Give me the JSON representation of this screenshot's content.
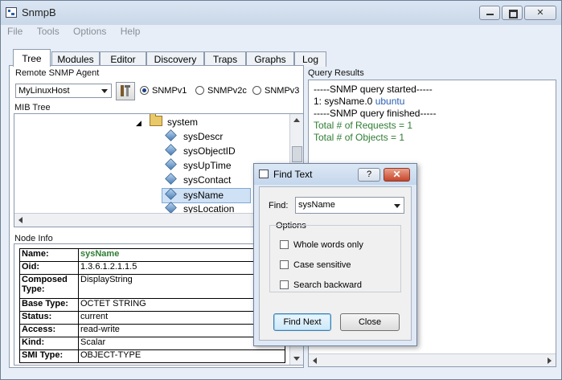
{
  "window": {
    "title": "SnmpB"
  },
  "menu": [
    "File",
    "Tools",
    "Options",
    "Help"
  ],
  "tabs": [
    "Tree",
    "Modules",
    "Editor",
    "Discovery",
    "Traps",
    "Graphs",
    "Log"
  ],
  "agent": {
    "group_label": "Remote SNMP Agent",
    "host": "MyLinuxHost",
    "versions": [
      "SNMPv1",
      "SNMPv2c",
      "SNMPv3"
    ],
    "selected_version": "SNMPv1"
  },
  "mib_tree": {
    "label": "MIB Tree",
    "root": "system",
    "items": [
      "sysDescr",
      "sysObjectID",
      "sysUpTime",
      "sysContact",
      "sysName",
      "sysLocation"
    ],
    "selected": "sysName"
  },
  "node_info": {
    "label": "Node Info",
    "rows": [
      {
        "key": "Name:",
        "value": "sysName"
      },
      {
        "key": "Oid:",
        "value": "1.3.6.1.2.1.1.5"
      },
      {
        "key": "Composed Type:",
        "value": "DisplayString"
      },
      {
        "key": "Base Type:",
        "value": "OCTET STRING"
      },
      {
        "key": "Status:",
        "value": "current"
      },
      {
        "key": "Access:",
        "value": "read-write"
      },
      {
        "key": "Kind:",
        "value": "Scalar"
      },
      {
        "key": "SMI Type:",
        "value": "OBJECT-TYPE"
      }
    ]
  },
  "query_results": {
    "label": "Query Results",
    "line1": "-----SNMP query started-----",
    "line2_prefix": "1: sysName.0",
    "line2_value": "ubuntu",
    "line3": "-----SNMP query finished-----",
    "line4": "Total # of Requests = 1",
    "line5": "Total # of Objects = 1"
  },
  "find_dialog": {
    "title": "Find Text",
    "help": "?",
    "find_label": "Find:",
    "find_value": "sysName",
    "options_label": "Options",
    "options": [
      "Whole words only",
      "Case sensitive",
      "Search backward"
    ],
    "find_next": "Find Next",
    "close": "Close"
  },
  "colors": {
    "accent": "#2a5fb0",
    "result_green": "#2e7d32"
  }
}
